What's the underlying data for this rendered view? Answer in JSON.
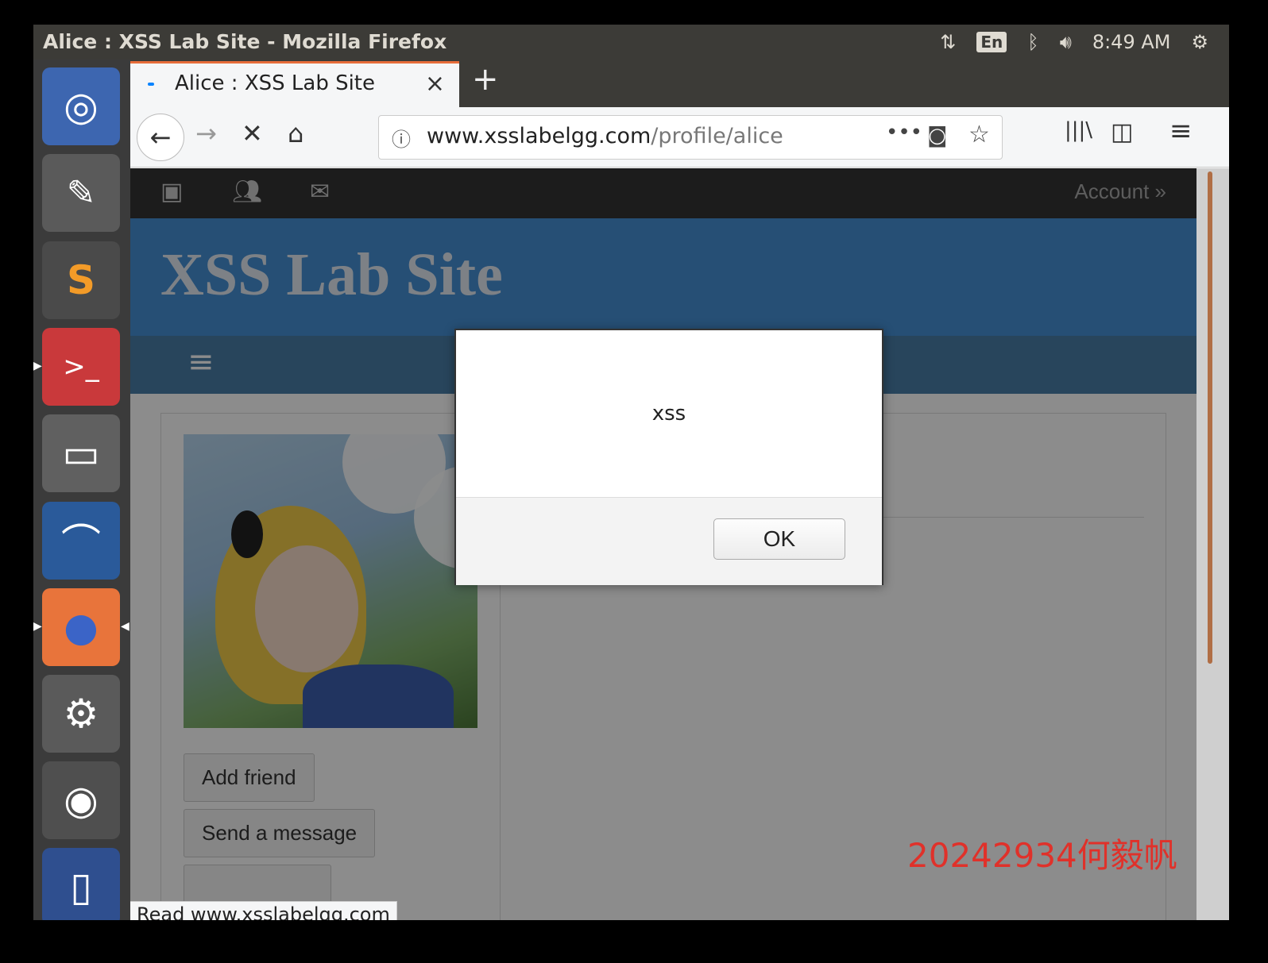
{
  "window": {
    "title": "Alice : XSS Lab Site - Mozilla Firefox"
  },
  "tray": {
    "keyboard": "En",
    "clock": "8:49 AM"
  },
  "launcher": {
    "items": [
      {
        "name": "ubuntu-dash-icon",
        "glyph": "◎"
      },
      {
        "name": "text-editor-icon",
        "glyph": "✎"
      },
      {
        "name": "sublime-text-icon",
        "glyph": "S"
      },
      {
        "name": "terminal-icon",
        "glyph": ">_"
      },
      {
        "name": "file-manager-icon",
        "glyph": "▭"
      },
      {
        "name": "wireshark-icon",
        "glyph": "⌒"
      },
      {
        "name": "firefox-icon",
        "glyph": "●"
      },
      {
        "name": "system-settings-icon",
        "glyph": "⚙"
      },
      {
        "name": "dvd-icon",
        "glyph": "◉"
      },
      {
        "name": "trash-icon",
        "glyph": "▯"
      }
    ]
  },
  "tab": {
    "label": "Alice : XSS Lab Site",
    "close": "×",
    "new_tab": "+"
  },
  "nav": {
    "back": "←",
    "forward": "→",
    "stop": "✕",
    "home": "⌂",
    "url_domain": "www.xsslabelgg.com",
    "url_path": "/profile/alice",
    "info": "ⓘ",
    "more": "•••",
    "pocket": "◙",
    "star": "☆",
    "library": "|||\\",
    "sidebar": "◫",
    "menu": "≡"
  },
  "site": {
    "account": "Account »",
    "title": "XSS Lab Site",
    "hamburger": "≡"
  },
  "profile": {
    "add_friend": "Add friend",
    "send_message": "Send a message"
  },
  "dialog": {
    "message": "xss",
    "ok_label": "OK"
  },
  "status": "Read www.xsslabelgg.com",
  "watermark": "20242934何毅帆"
}
